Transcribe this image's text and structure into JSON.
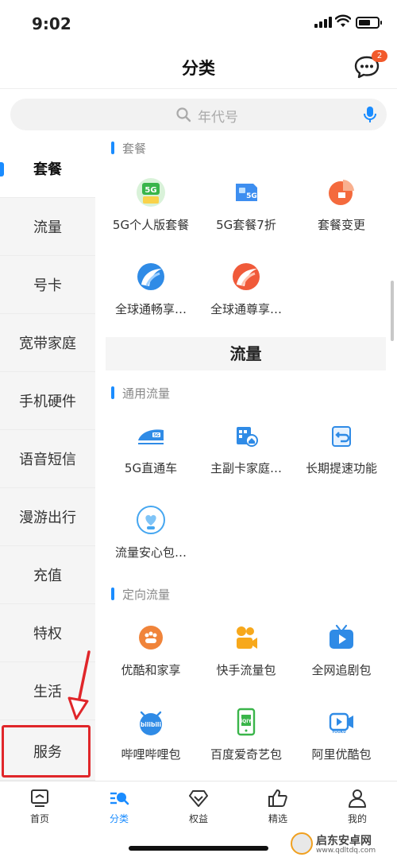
{
  "status_bar": {
    "time": "9:02"
  },
  "header": {
    "title": "分类",
    "badge": "2"
  },
  "search": {
    "placeholder": "年代号"
  },
  "sidebar": {
    "items": [
      {
        "label": "套餐",
        "active": true
      },
      {
        "label": "流量"
      },
      {
        "label": "号卡"
      },
      {
        "label": "宽带家庭"
      },
      {
        "label": "手机硬件"
      },
      {
        "label": "语音短信"
      },
      {
        "label": "漫游出行"
      },
      {
        "label": "充值"
      },
      {
        "label": "特权"
      },
      {
        "label": "生活"
      },
      {
        "label": "服务"
      }
    ]
  },
  "content": {
    "taocan_title": "套餐",
    "taocan_items": [
      {
        "label": "5G个人版套餐",
        "icon": "5g-plan-icon"
      },
      {
        "label": "5G套餐7折",
        "icon": "5g-sim-icon"
      },
      {
        "label": "套餐变更",
        "icon": "pie-chart-icon"
      },
      {
        "label": "全球通畅享…",
        "icon": "global-blue-icon"
      },
      {
        "label": "全球通尊享…",
        "icon": "global-red-icon"
      }
    ],
    "liuliang_band": "流量",
    "tongyong_title": "通用流量",
    "tongyong_items": [
      {
        "label": "5G直通车",
        "icon": "5g-train-icon"
      },
      {
        "label": "主副卡家庭…",
        "icon": "family-card-icon"
      },
      {
        "label": "长期提速功能",
        "icon": "speed-boost-icon"
      },
      {
        "label": "流量安心包…",
        "icon": "heart-data-icon"
      }
    ],
    "dingxiang_title": "定向流量",
    "dingxiang_items": [
      {
        "label": "优酷和家享",
        "icon": "youku-family-icon"
      },
      {
        "label": "快手流量包",
        "icon": "kuaishou-icon"
      },
      {
        "label": "全网追剧包",
        "icon": "tv-play-icon"
      },
      {
        "label": "哔哩哔哩包",
        "icon": "bilibili-icon"
      },
      {
        "label": "百度爱奇艺包",
        "icon": "iqiyi-icon"
      },
      {
        "label": "阿里优酷包",
        "icon": "youku-icon"
      }
    ]
  },
  "tabbar": {
    "items": [
      {
        "label": "首页"
      },
      {
        "label": "分类",
        "active": true
      },
      {
        "label": "权益"
      },
      {
        "label": "精选"
      },
      {
        "label": "我的"
      }
    ]
  },
  "watermark": {
    "title": "启东安卓网",
    "url": "www.qdltdq.com"
  },
  "colors": {
    "accent": "#1a8cff",
    "highlight": "#e0262a",
    "badge": "#f25a2c"
  }
}
